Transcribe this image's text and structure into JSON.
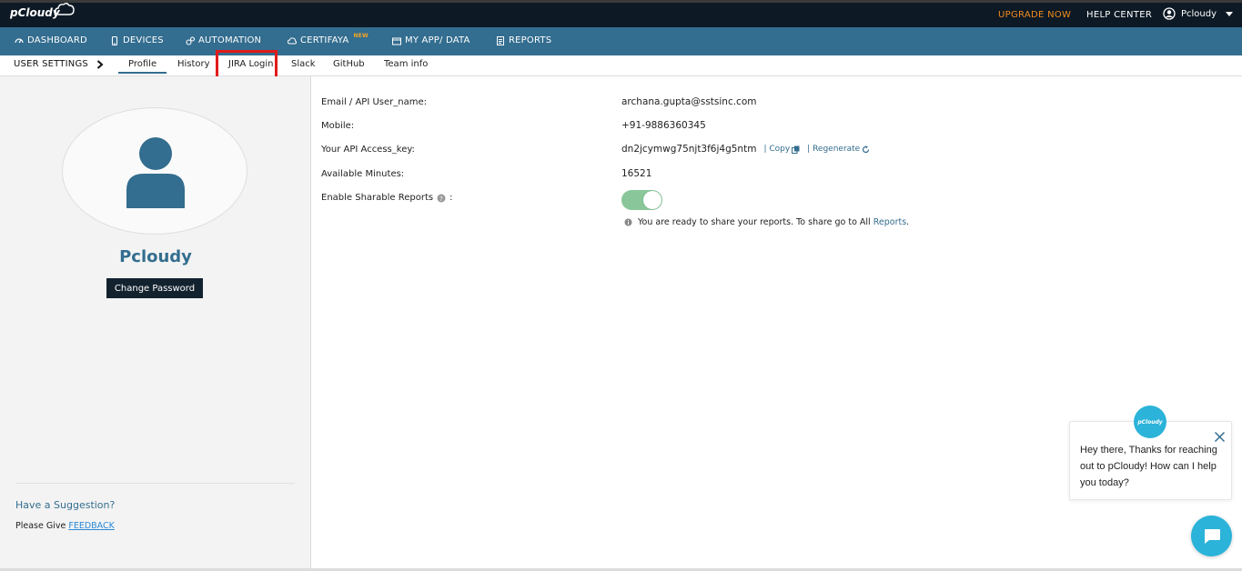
{
  "topbar": {
    "logo_text": "pCloudy",
    "upgrade_label": "UPGRADE NOW",
    "help_label": "HELP CENTER",
    "user_label": "Pcloudy"
  },
  "nav": {
    "items": [
      {
        "label": "DASHBOARD",
        "icon": "dashboard-icon"
      },
      {
        "label": "DEVICES",
        "icon": "mobile-device-icon"
      },
      {
        "label": "AUTOMATION",
        "icon": "gears-icon"
      },
      {
        "label": "CERTIFAYA",
        "icon": "cloud-icon",
        "badge": "NEW"
      },
      {
        "label": "MY APP/ DATA",
        "icon": "folder-icon"
      },
      {
        "label": "REPORTS",
        "icon": "report-icon"
      }
    ]
  },
  "subnav": {
    "settings_label": "USER SETTINGS",
    "tabs": [
      "Profile",
      "History",
      "JIRA Login",
      "Slack",
      "GitHub",
      "Team info"
    ],
    "active_tab": "Profile",
    "highlighted_tab": "JIRA Login"
  },
  "sidebar": {
    "user_name": "Pcloudy",
    "change_password_label": "Change Password",
    "suggestion_label": "Have a Suggestion?",
    "feedback_prefix": "Please Give",
    "feedback_link": "FEEDBACK"
  },
  "profile": {
    "email_label": "Email / API User_name:",
    "email_value": "archana.gupta@sstsinc.com",
    "mobile_label": "Mobile:",
    "mobile_value": "+91-9886360345",
    "api_key_label": "Your API Access_key:",
    "api_key_value": "dn2jcymwg75njt3f6j4g5ntm",
    "copy_label": "| Copy",
    "regenerate_label": "| Regenerate",
    "minutes_label": "Available Minutes:",
    "minutes_value": "16521",
    "sharable_label": "Enable Sharable Reports",
    "sharable_colon": ":",
    "sharable_enabled": true,
    "share_note_text": "You are ready to share your reports. To share go to All",
    "share_note_link": "Reports",
    "share_note_end": "."
  },
  "chat": {
    "logo_text": "pCloudy",
    "message": "Hey there, Thanks for reaching out to pCloudy! How can I help you today?"
  },
  "colors": {
    "topbar_bg": "#0d1a25",
    "nav_bg": "#336d8f",
    "accent": "#336d8f",
    "upgrade": "#f08a1c",
    "toggle_on": "#89c79a",
    "chat": "#2bb3d9",
    "highlight": "#e21a1a"
  }
}
